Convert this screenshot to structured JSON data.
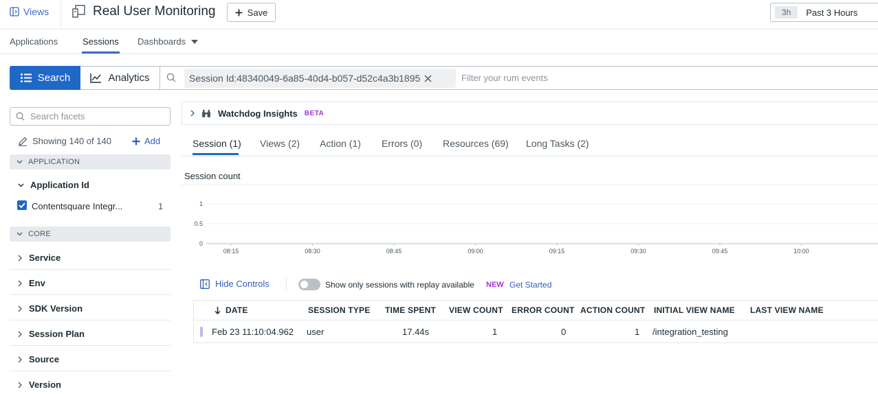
{
  "header": {
    "views_label": "Views",
    "app_title": "Real User Monitoring",
    "save_label": "Save",
    "time_short": "3h",
    "time_label": "Past 3 Hours"
  },
  "nav": {
    "tabs": [
      {
        "label": "Applications"
      },
      {
        "label": "Sessions"
      },
      {
        "label": "Dashboards"
      }
    ]
  },
  "search": {
    "search_label": "Search",
    "analytics_label": "Analytics",
    "query_chip": "Session Id:48340049-6a85-40d4-b057-d52c4a3b1895",
    "placeholder": "Filter your rum events"
  },
  "facets": {
    "search_placeholder": "Search facets",
    "showing": "Showing 140 of 140",
    "add_label": "Add",
    "group_application": "APPLICATION",
    "application_id_title": "Application Id",
    "application_value": "Contentsquare Integr...",
    "application_count": "1",
    "group_core": "CORE",
    "core_items": [
      {
        "label": "Service"
      },
      {
        "label": "Env"
      },
      {
        "label": "SDK Version"
      },
      {
        "label": "Session Plan"
      },
      {
        "label": "Source"
      },
      {
        "label": "Version"
      }
    ]
  },
  "watchdog": {
    "title": "Watchdog Insights",
    "badge": "BETA"
  },
  "subtabs": [
    {
      "label": "Session (1)"
    },
    {
      "label": "Views (2)"
    },
    {
      "label": "Action (1)"
    },
    {
      "label": "Errors (0)"
    },
    {
      "label": "Resources (69)"
    },
    {
      "label": "Long Tasks (2)"
    }
  ],
  "chart_data": {
    "type": "bar",
    "title": "Session count",
    "categories": [
      "08:15",
      "08:30",
      "08:45",
      "09:00",
      "09:15",
      "09:30",
      "09:45",
      "10:00"
    ],
    "values": [
      0,
      0,
      0,
      0,
      0,
      0,
      0,
      0
    ],
    "y_ticks": [
      "1",
      "0.5",
      "0"
    ],
    "ylim": [
      0,
      1
    ],
    "grid": true
  },
  "controls": {
    "hide_controls": "Hide Controls",
    "replay_toggle_label": "Show only sessions with replay available",
    "new_badge": "NEW",
    "get_started": "Get Started"
  },
  "table": {
    "headers": {
      "date": "DATE",
      "session_type": "SESSION TYPE",
      "time_spent": "TIME SPENT",
      "view_count": "VIEW COUNT",
      "error_count": "ERROR COUNT",
      "action_count": "ACTION COUNT",
      "initial_view": "INITIAL VIEW NAME",
      "last_view": "LAST VIEW NAME"
    },
    "rows": [
      {
        "date": "Feb 23 11:10:04.962",
        "session_type": "user",
        "time_spent": "17.44s",
        "view_count": "1",
        "error_count": "0",
        "action_count": "1",
        "initial_view": "/integration_testing",
        "last_view": ""
      }
    ]
  }
}
